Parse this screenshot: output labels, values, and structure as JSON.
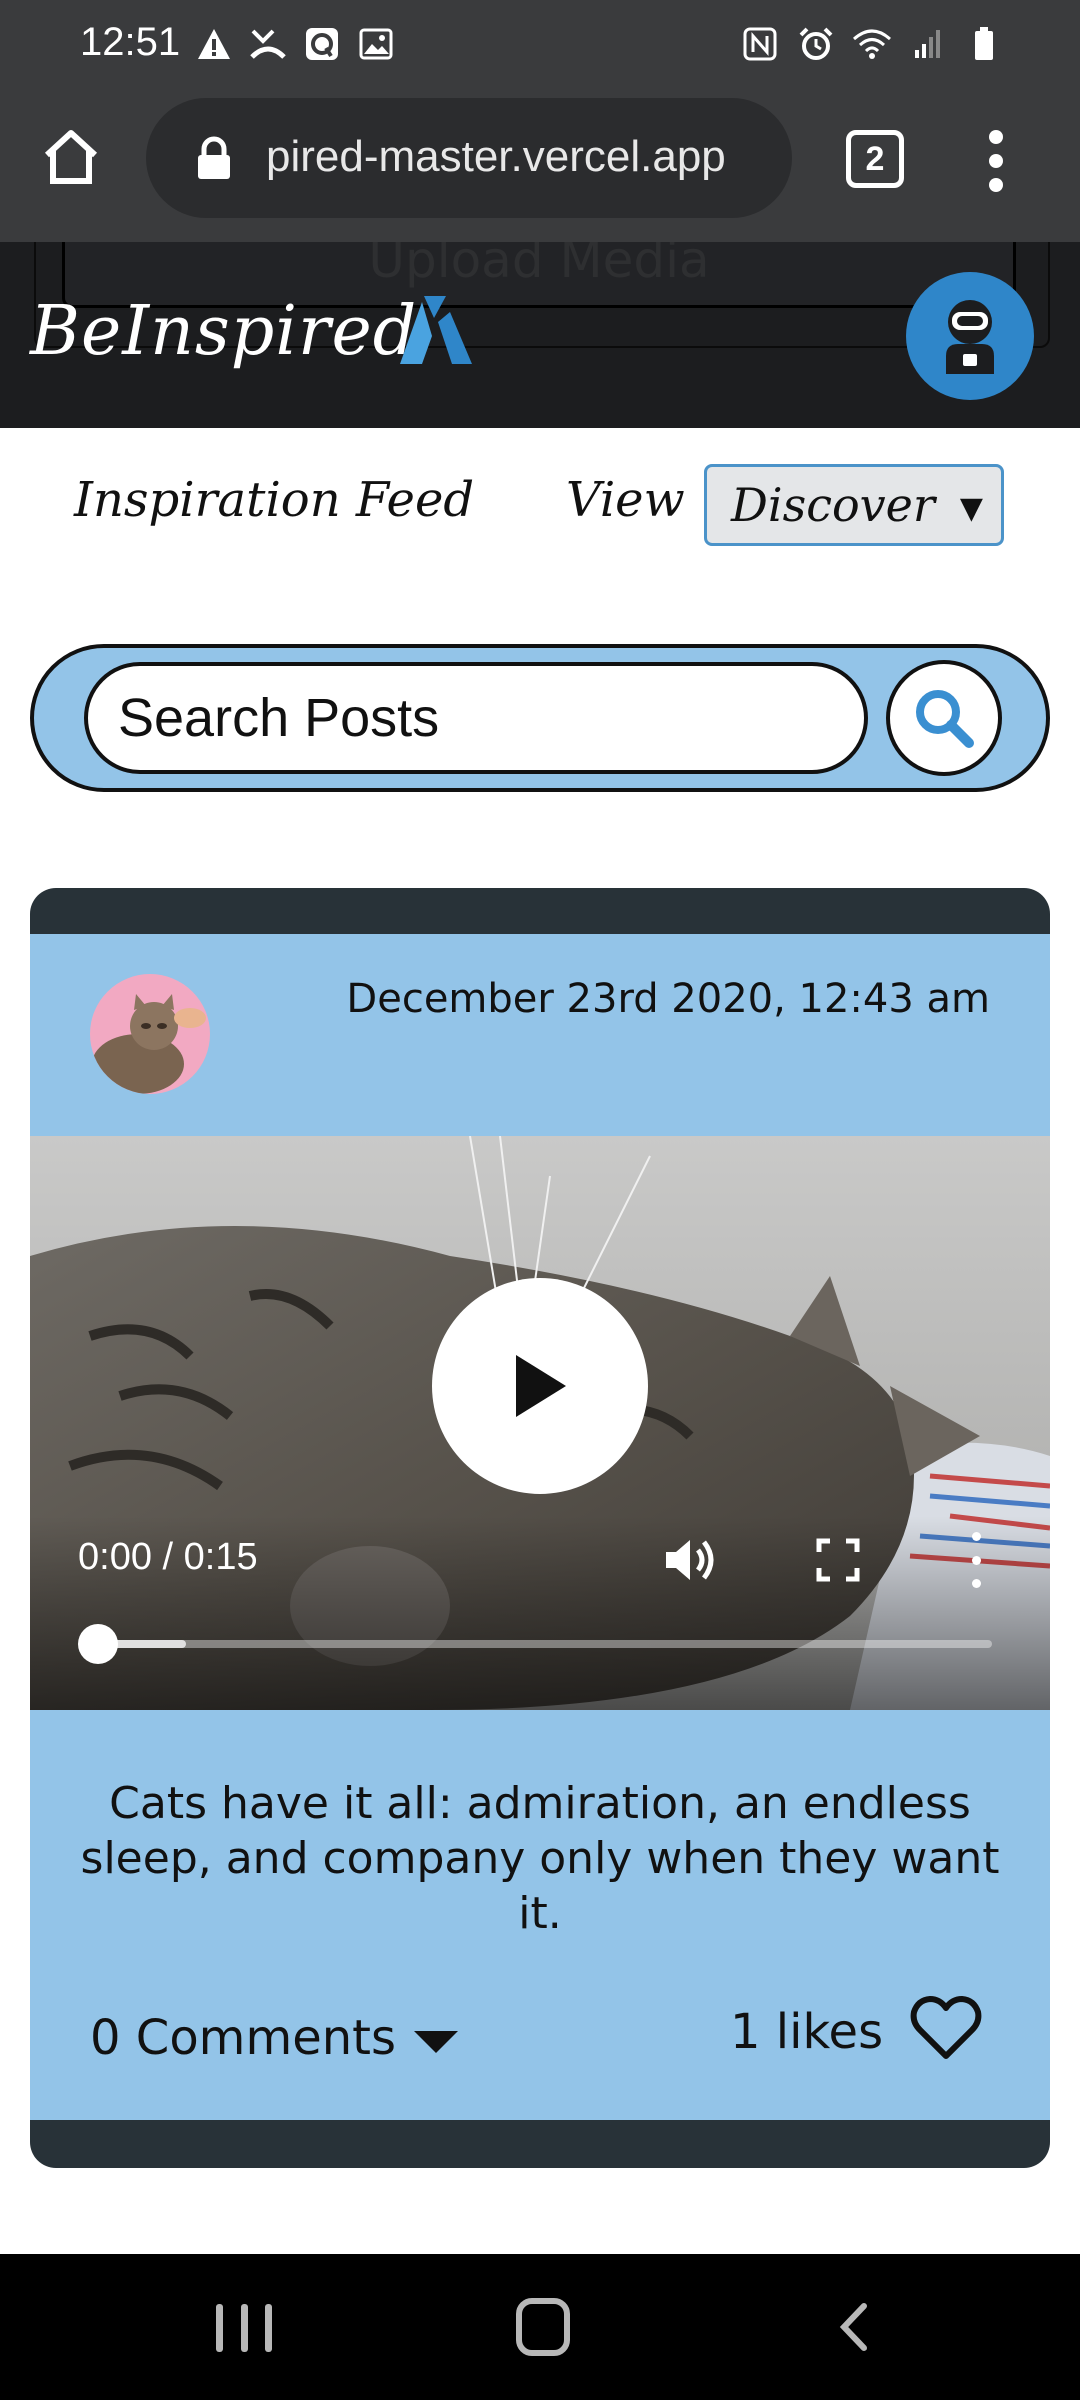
{
  "status_bar": {
    "time": "12:51",
    "left_icons": [
      "warning-icon",
      "missed-call-icon",
      "quip-app-icon",
      "gallery-icon"
    ],
    "right_icons": [
      "nfc-icon",
      "alarm-icon",
      "wifi-icon",
      "signal-icon",
      "battery-icon"
    ]
  },
  "browser": {
    "url": "pired-master.vercel.app",
    "tab_count": "2"
  },
  "app": {
    "upload_ghost_label": "Upload Media",
    "brand_name": "BeInspired",
    "accent_color": "#93c4e8",
    "brand_blue": "#2f86c9"
  },
  "feed": {
    "title": "Inspiration Feed",
    "view_label": "View",
    "view_selected": "Discover"
  },
  "search": {
    "placeholder": "Search Posts"
  },
  "post": {
    "date": "December 23rd 2020, 12:43 am",
    "video": {
      "time": "0:00 / 0:15",
      "buffered_fraction": 0.1
    },
    "caption": "Cats have it all: admiration, an endless sleep, and company only when they want it.",
    "comments_label": "0 Comments",
    "likes_label": "1 likes"
  }
}
